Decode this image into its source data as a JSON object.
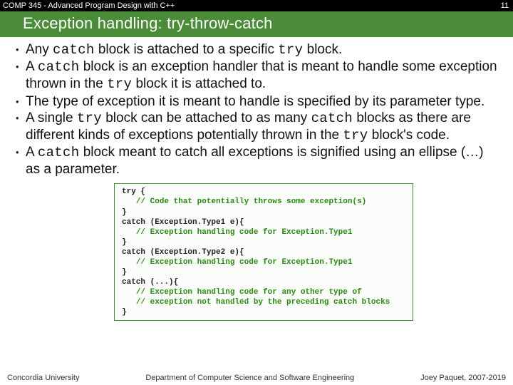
{
  "header": {
    "course": "COMP 345 - Advanced Program Design with C++",
    "slide_number": "11",
    "title": "Exception handling: try-throw-catch"
  },
  "bullets": [
    {
      "segments": [
        {
          "t": "Any "
        },
        {
          "t": "catch",
          "code": true
        },
        {
          "t": " block is attached to a specific "
        },
        {
          "t": "try",
          "code": true
        },
        {
          "t": " block."
        }
      ]
    },
    {
      "segments": [
        {
          "t": "A "
        },
        {
          "t": "catch",
          "code": true
        },
        {
          "t": " block is an exception handler that is meant to handle some exception thrown in the "
        },
        {
          "t": "try",
          "code": true
        },
        {
          "t": " block it is attached to."
        }
      ]
    },
    {
      "segments": [
        {
          "t": "The type of exception it is meant to handle is specified by its parameter type."
        }
      ]
    },
    {
      "segments": [
        {
          "t": "A single "
        },
        {
          "t": "try",
          "code": true
        },
        {
          "t": " block can be attached to as many "
        },
        {
          "t": "catch",
          "code": true
        },
        {
          "t": " blocks as there are different kinds of exceptions potentially thrown in the "
        },
        {
          "t": "try",
          "code": true
        },
        {
          "t": " block's code."
        }
      ]
    },
    {
      "segments": [
        {
          "t": "A "
        },
        {
          "t": "catch",
          "code": true
        },
        {
          "t": " block meant to catch all exceptions is signified using an ellipse (…) as a parameter."
        }
      ]
    }
  ],
  "code": {
    "lines": [
      [
        {
          "t": "try {"
        }
      ],
      [
        {
          "t": "   "
        },
        {
          "t": "// Code that potentially throws some exception(s)",
          "cmt": true
        }
      ],
      [
        {
          "t": "}"
        }
      ],
      [
        {
          "t": "catch (Exception.Type1 e){"
        }
      ],
      [
        {
          "t": "   "
        },
        {
          "t": "// Exception handling code for Exception.Type1",
          "cmt": true
        }
      ],
      [
        {
          "t": "}"
        }
      ],
      [
        {
          "t": "catch (Exception.Type2 e){"
        }
      ],
      [
        {
          "t": "   "
        },
        {
          "t": "// Exception handling code for Exception.Type1",
          "cmt": true
        }
      ],
      [
        {
          "t": "}"
        }
      ],
      [
        {
          "t": "catch (...){"
        }
      ],
      [
        {
          "t": "   "
        },
        {
          "t": "// Exception handling code for any other type of",
          "cmt": true
        }
      ],
      [
        {
          "t": "   "
        },
        {
          "t": "// exception not handled by the preceding catch blocks",
          "cmt": true
        }
      ],
      [
        {
          "t": "}"
        }
      ]
    ]
  },
  "footer": {
    "left": "Concordia University",
    "center": "Department of Computer Science and Software Engineering",
    "right": "Joey Paquet, 2007-2019"
  }
}
